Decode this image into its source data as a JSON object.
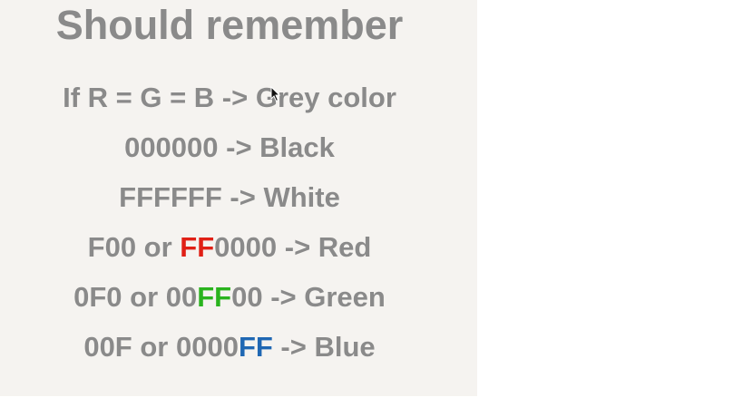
{
  "title": "Should remember",
  "lines": [
    {
      "parts": [
        "If R = G = B -> Grey color"
      ]
    },
    {
      "parts": [
        "000000 -> Black"
      ]
    },
    {
      "parts": [
        "FFFFFF -> White"
      ]
    },
    {
      "pre": "F00 or ",
      "highlight": "FF",
      "post": "0000 -> Red",
      "highlight_color": "#e02016"
    },
    {
      "pre": "0F0 or 00",
      "highlight": "FF",
      "post": "00 -> Green",
      "highlight_color": "#2ab31e"
    },
    {
      "pre": "00F or 0000",
      "highlight": "FF",
      "post": " -> Blue",
      "highlight_color": "#1f67b3"
    }
  ],
  "colors": {
    "text": "#8a8a8a",
    "slide_background": "#f5f3f0",
    "red": "#e02016",
    "green": "#2ab31e",
    "blue": "#1f67b3"
  },
  "icons": {
    "cursor": "mouse-pointer-icon"
  }
}
